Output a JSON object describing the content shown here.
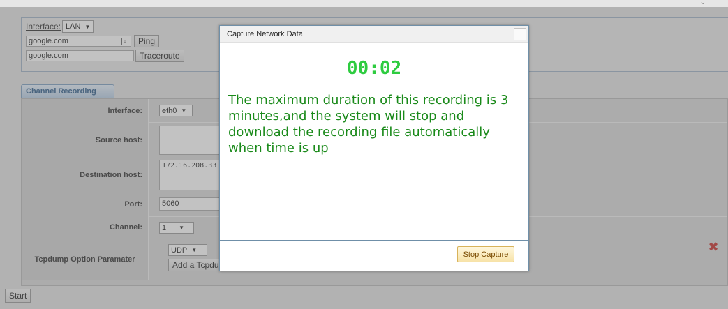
{
  "diagnostics": {
    "interface_label": "Interface:",
    "interface_value": "LAN",
    "ping_host": "google.com",
    "ping_button": "Ping",
    "traceroute_host": "google.com",
    "traceroute_button": "Traceroute"
  },
  "tab": {
    "label": "Channel Recording"
  },
  "recording": {
    "interface": {
      "label": "Interface:",
      "value": "eth0"
    },
    "source_host": {
      "label": "Source host:",
      "value": ""
    },
    "destination_host": {
      "label": "Destination host:",
      "value": "172.16.208.33"
    },
    "port": {
      "label": "Port:",
      "value": "5060"
    },
    "channel": {
      "label": "Channel:",
      "value": "1"
    },
    "tcpdump": {
      "label": "Tcpdump Option Paramater",
      "protocol": "UDP",
      "add_button": "Add a Tcpdump parameter option"
    }
  },
  "start_button": "Start",
  "modal": {
    "title": "Capture Network Data",
    "timer": "00:02",
    "message": "The maximum duration of this recording is 3 minutes,and the system will stop and download the recording file automatically when time is up",
    "stop_button": "Stop Capture"
  },
  "colors": {
    "timer": "#2ecc40",
    "message": "#1a8a1a",
    "stop_button_bg": "#f7e3a8",
    "delete_icon": "#c9302c"
  }
}
